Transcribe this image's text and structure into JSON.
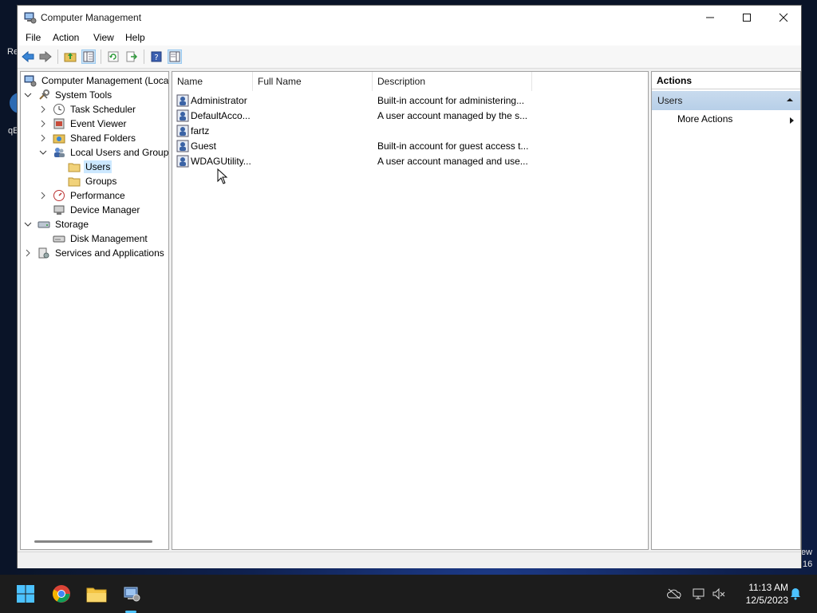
{
  "window": {
    "title": "Computer Management"
  },
  "menu": [
    "File",
    "Action",
    "View",
    "Help"
  ],
  "tree": {
    "root": "Computer Management (Local",
    "system_tools": "System Tools",
    "task_scheduler": "Task Scheduler",
    "event_viewer": "Event Viewer",
    "shared_folders": "Shared Folders",
    "local_users_groups": "Local Users and Groups",
    "users": "Users",
    "groups": "Groups",
    "performance": "Performance",
    "device_manager": "Device Manager",
    "storage": "Storage",
    "disk_management": "Disk Management",
    "services_apps": "Services and Applications"
  },
  "list": {
    "columns": [
      "Name",
      "Full Name",
      "Description"
    ],
    "rows": [
      {
        "name": "Administrator",
        "full_name": "",
        "description": "Built-in account for administering..."
      },
      {
        "name": "DefaultAcco...",
        "full_name": "",
        "description": "A user account managed by the s..."
      },
      {
        "name": "fartz",
        "full_name": "",
        "description": ""
      },
      {
        "name": "Guest",
        "full_name": "",
        "description": "Built-in account for guest access t..."
      },
      {
        "name": "WDAGUtility...",
        "full_name": "",
        "description": "A user account managed and use..."
      }
    ]
  },
  "actions": {
    "title": "Actions",
    "section": "Users",
    "more": "More Actions"
  },
  "desktop_fragments": [
    "Re",
    "qE",
    "ew",
    "16"
  ],
  "taskbar": {
    "time": "11:13 AM",
    "date": "12/5/2023"
  },
  "colors": {
    "selection": "#cce8ff",
    "actions_header": "#b7cfe8",
    "taskbar": "#1c1c1c",
    "accent": "#4cc2ff"
  }
}
